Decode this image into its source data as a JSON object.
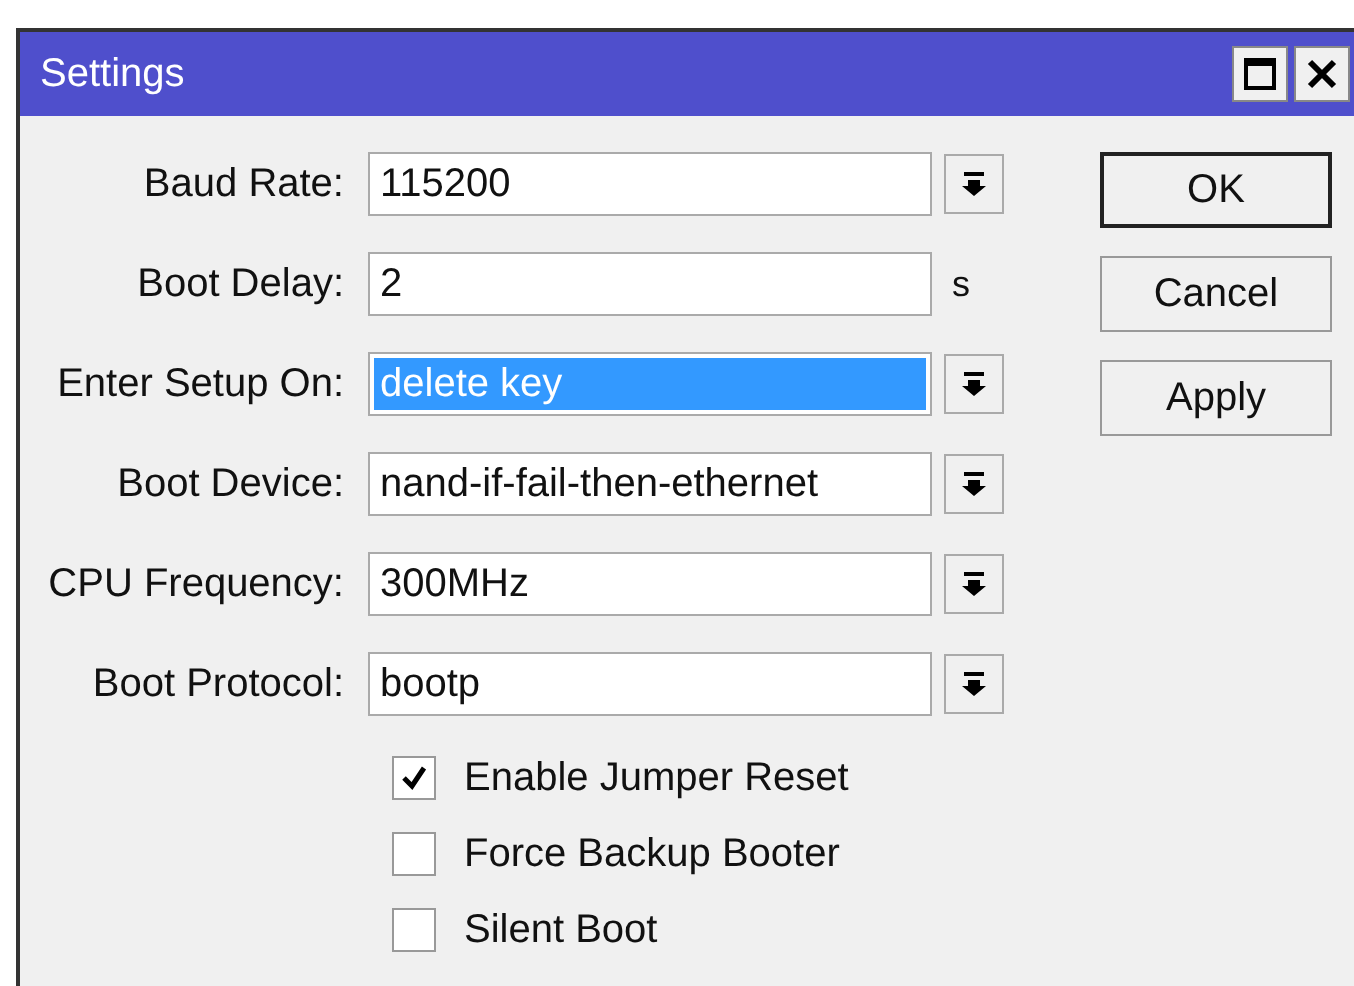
{
  "window": {
    "title": "Settings"
  },
  "fields": [
    {
      "label": "Baud Rate:",
      "kind": "dropdown",
      "value": "115200",
      "highlighted": false
    },
    {
      "label": "Boot Delay:",
      "kind": "text",
      "value": "2",
      "unit": "s",
      "highlighted": false
    },
    {
      "label": "Enter Setup On:",
      "kind": "dropdown",
      "value": "delete key",
      "highlighted": true
    },
    {
      "label": "Boot Device:",
      "kind": "dropdown",
      "value": "nand-if-fail-then-ethernet",
      "highlighted": false
    },
    {
      "label": "CPU Frequency:",
      "kind": "dropdown",
      "value": "300MHz",
      "highlighted": false
    },
    {
      "label": "Boot Protocol:",
      "kind": "dropdown",
      "value": "bootp",
      "highlighted": false
    }
  ],
  "checkboxes": [
    {
      "label": "Enable Jumper Reset",
      "checked": true
    },
    {
      "label": "Force Backup Booter",
      "checked": false
    },
    {
      "label": "Silent Boot",
      "checked": false
    }
  ],
  "buttons": [
    "OK",
    "Cancel",
    "Apply"
  ]
}
